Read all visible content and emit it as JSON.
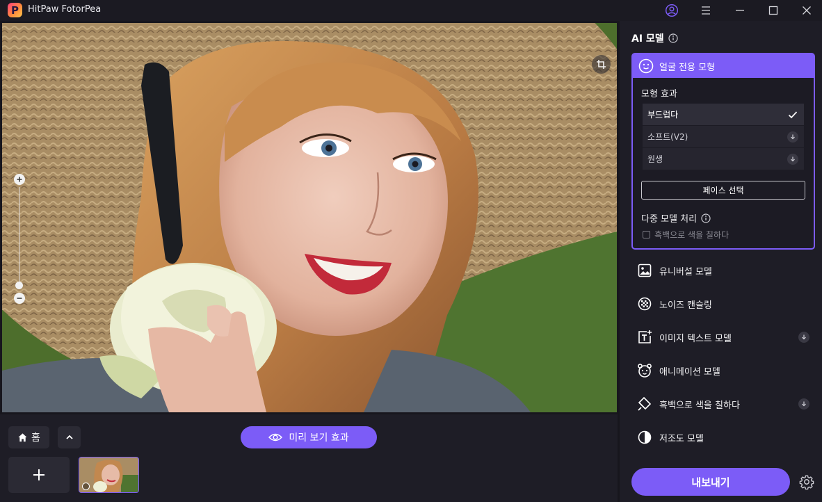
{
  "app": {
    "title": "HitPaw FotorPea",
    "logo_letter": "P"
  },
  "colors": {
    "accent": "#7c5cf7",
    "panel_bg": "#1e1d26",
    "window_bg": "#17161d"
  },
  "bottom": {
    "home_label": "홈",
    "preview_label": "미리 보기 효과"
  },
  "panel": {
    "title": "AI 모델",
    "face_model": {
      "label": "얼굴 전용 모형",
      "effect_label": "모형 효과",
      "options": [
        {
          "label": "부드럽다",
          "state": "selected"
        },
        {
          "label": "소프트(V2)",
          "state": "download"
        },
        {
          "label": "원생",
          "state": "download"
        }
      ],
      "face_select_label": "페이스 선택",
      "multi_label": "다중 모델 처리",
      "colorize_checkbox_label": "흑백으로 색을 칠하다",
      "colorize_checked": false
    },
    "models": [
      {
        "label": "유니버설 모델",
        "icon": "image-icon",
        "download": false
      },
      {
        "label": "노이즈 캔슬링",
        "icon": "noise-icon",
        "download": false
      },
      {
        "label": "이미지 텍스트 모델",
        "icon": "text-image-icon",
        "download": true
      },
      {
        "label": "애니메이션 모델",
        "icon": "anime-face-icon",
        "download": false
      },
      {
        "label": "흑백으로 색을 칠하다",
        "icon": "paint-bucket-icon",
        "download": true
      },
      {
        "label": "저조도 모델",
        "icon": "contrast-icon",
        "download": false
      }
    ],
    "export_label": "내보내기"
  }
}
